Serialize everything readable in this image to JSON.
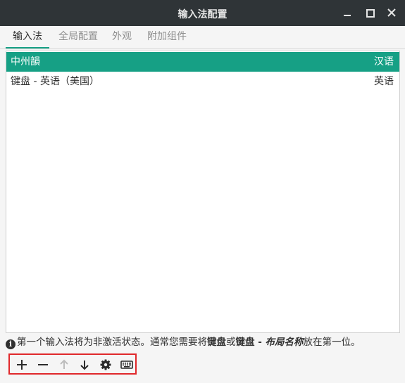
{
  "window": {
    "title": "输入法配置"
  },
  "tabs": [
    {
      "label": "输入法",
      "active": true
    },
    {
      "label": "全局配置",
      "active": false
    },
    {
      "label": "外观",
      "active": false
    },
    {
      "label": "附加组件",
      "active": false
    }
  ],
  "input_methods": [
    {
      "name": "中州韻",
      "language": "汉语",
      "selected": true
    },
    {
      "name": "键盘 - 英语（美国）",
      "language": "英语",
      "selected": false
    }
  ],
  "hint": {
    "icon": "info-icon",
    "prefix": "第一个输入法将为非激活状态。通常您需要将",
    "bold1": "键盘",
    "middle": "或",
    "bold2": "键盘 - ",
    "italic": "布局名称",
    "suffix": "放在第一位。"
  },
  "toolbar": {
    "buttons": [
      {
        "icon": "add-icon",
        "enabled": true
      },
      {
        "icon": "remove-icon",
        "enabled": true
      },
      {
        "icon": "move-up-icon",
        "enabled": false
      },
      {
        "icon": "move-down-icon",
        "enabled": true
      },
      {
        "icon": "settings-icon",
        "enabled": true
      },
      {
        "icon": "keyboard-layout-icon",
        "enabled": true
      }
    ]
  },
  "colors": {
    "accent": "#16a085",
    "titlebar": "#2f3437",
    "highlight_border": "#e0282b"
  }
}
